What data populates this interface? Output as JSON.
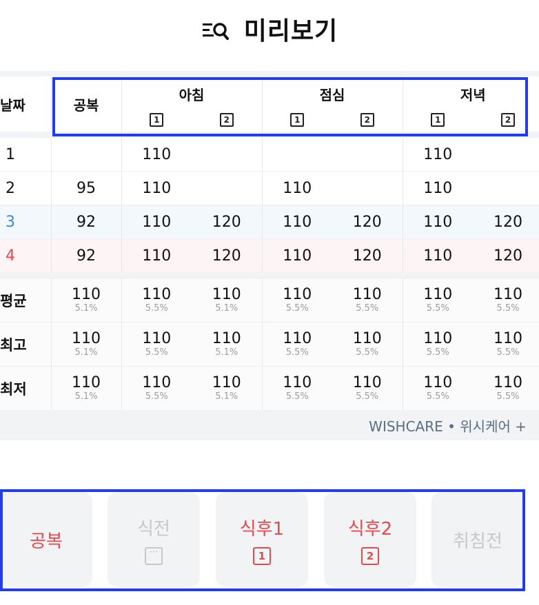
{
  "header": {
    "title": "미리보기",
    "icon": "search-list-icon"
  },
  "table": {
    "col_date": "날짜",
    "col_fasting": "공복",
    "meals": [
      "아침",
      "점심",
      "저녁"
    ],
    "slot_labels": [
      "1",
      "2"
    ],
    "rows": [
      {
        "date": "1",
        "fasting": "",
        "values": [
          "110",
          "",
          "",
          "",
          "110",
          ""
        ],
        "day": "weekday"
      },
      {
        "date": "2",
        "fasting": "95",
        "values": [
          "110",
          "",
          "110",
          "",
          "110",
          ""
        ],
        "day": "weekday"
      },
      {
        "date": "3",
        "fasting": "92",
        "values": [
          "110",
          "120",
          "110",
          "120",
          "110",
          "120"
        ],
        "day": "saturday"
      },
      {
        "date": "4",
        "fasting": "92",
        "values": [
          "110",
          "120",
          "110",
          "120",
          "110",
          "120"
        ],
        "day": "sunday"
      }
    ],
    "stats": [
      {
        "label": "평균",
        "cells": [
          {
            "v": "110",
            "p": "5.1%"
          },
          {
            "v": "110",
            "p": "5.5%"
          },
          {
            "v": "110",
            "p": "5.1%"
          },
          {
            "v": "110",
            "p": "5.5%"
          },
          {
            "v": "110",
            "p": "5.5%"
          },
          {
            "v": "110",
            "p": "5.5%"
          },
          {
            "v": "110",
            "p": "5.5%"
          }
        ]
      },
      {
        "label": "최고",
        "cells": [
          {
            "v": "110",
            "p": "5.1%"
          },
          {
            "v": "110",
            "p": "5.5%"
          },
          {
            "v": "110",
            "p": "5.1%"
          },
          {
            "v": "110",
            "p": "5.5%"
          },
          {
            "v": "110",
            "p": "5.5%"
          },
          {
            "v": "110",
            "p": "5.5%"
          },
          {
            "v": "110",
            "p": "5.5%"
          }
        ]
      },
      {
        "label": "최저",
        "cells": [
          {
            "v": "110",
            "p": "5.1%"
          },
          {
            "v": "110",
            "p": "5.5%"
          },
          {
            "v": "110",
            "p": "5.1%"
          },
          {
            "v": "110",
            "p": "5.5%"
          },
          {
            "v": "110",
            "p": "5.5%"
          },
          {
            "v": "110",
            "p": "5.5%"
          },
          {
            "v": "110",
            "p": "5.5%"
          }
        ]
      }
    ],
    "brand": "WISHCARE • 위시케어 +"
  },
  "buttons": [
    {
      "label": "공복",
      "state": "active",
      "icon": ""
    },
    {
      "label": "식전",
      "state": "disabled",
      "icon": "···"
    },
    {
      "label": "식후1",
      "state": "active",
      "icon": "1"
    },
    {
      "label": "식후2",
      "state": "active",
      "icon": "2"
    },
    {
      "label": "취침전",
      "state": "disabled",
      "icon": ""
    }
  ],
  "colors": {
    "accent_red": "#e24a4f",
    "saturday_blue": "#3a8ad8",
    "highlight_blue": "#1f3cf0"
  }
}
